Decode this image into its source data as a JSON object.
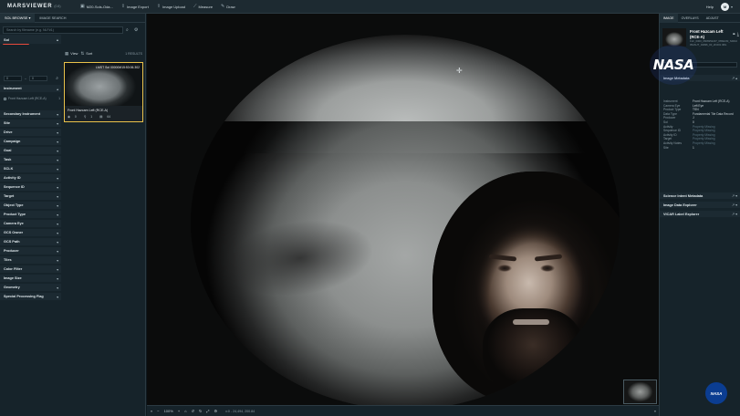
{
  "app": {
    "name": "MARSVIEWER",
    "version": "(0.8)"
  },
  "toolbar": {
    "items": [
      {
        "label": "M20-Sols-Oda...",
        "icon": "folder-icon"
      },
      {
        "label": "Image Export",
        "icon": "export-icon"
      },
      {
        "label": "Image Upload",
        "icon": "upload-icon"
      },
      {
        "label": "Measure",
        "icon": "ruler-icon"
      },
      {
        "label": "Draw",
        "icon": "pencil-icon"
      }
    ],
    "help": "Help",
    "user_initial": "M"
  },
  "left": {
    "tabs": [
      "SOL BROWSE",
      "IMAGE SEARCH"
    ],
    "search_placeholder": "Search by filename (e.g. NLF#1)",
    "chip": "Filter: Both",
    "sol_header": "Sol",
    "sol_from": "0",
    "sol_to": "0",
    "instrument_option": {
      "label": "Front Hazcam Left (RCE-A)",
      "count": "1"
    },
    "facets": [
      "Instrument",
      "Secondary Instrument",
      "Site",
      "Drive",
      "Campaign",
      "Goal",
      "Task",
      "SCLK",
      "Activity ID",
      "Sequence ID",
      "Target",
      "Object Type",
      "Product Type",
      "Camera Eye",
      "GCS Owner",
      "GCS Path",
      "Producer",
      "Tiles",
      "Color Filter",
      "Image Size",
      "Geometry",
      "Special Processing Flag"
    ],
    "results_view": "View",
    "results_sort": "Sort",
    "results_count": "1 RESULTS",
    "result": {
      "stamp": "LMST Sol 00000M15:53:06.302",
      "title": "Front Hazcam Left (RCE-A)",
      "meta": [
        "0",
        "1",
        "64"
      ]
    }
  },
  "viewer": {
    "zoom": "100%",
    "coords": "x:0 - 24,494, 200.84",
    "controls": [
      "«",
      "−",
      "100%",
      "+",
      "⌂",
      "↺",
      "↻",
      "⤢",
      "⚙"
    ],
    "expand": "»"
  },
  "right": {
    "tabs": [
      "IMAGE",
      "OVERLAYS",
      "ADJUST"
    ],
    "image_name": "Front Hazcam Left (RCE-A)",
    "file_id": "FLF_0000_0666952207_665ECM_N0010052AUT_04096_00_2I3J01.IMG",
    "sections": [
      "Image Metadata",
      "Science Intent Metadata",
      "Image Data Explorer",
      "VICAR Label Explorer"
    ],
    "metadata": [
      {
        "k": "Instrument",
        "v": "Front Hazcam Left (RCE-A)",
        "missing": false
      },
      {
        "k": "Camera Eye",
        "v": "Left Eye",
        "missing": false
      },
      {
        "k": "Product Type",
        "v": "TSN",
        "missing": false
      },
      {
        "k": "Data Type",
        "v": "Fundamental Tile Data Record",
        "missing": false
      },
      {
        "k": "Producer",
        "v": "J",
        "missing": false
      },
      {
        "k": "Sol",
        "v": "0",
        "missing": false
      },
      {
        "k": "Activity",
        "v": "Property Missing",
        "missing": true
      },
      {
        "k": "Sequence ID",
        "v": "Property Missing",
        "missing": true
      },
      {
        "k": "Activity ID",
        "v": "Property Missing",
        "missing": true
      },
      {
        "k": "Target",
        "v": "Property Missing",
        "missing": true
      },
      {
        "k": "Activity Notes",
        "v": "Property Missing",
        "missing": true
      },
      {
        "k": "Site",
        "v": "1",
        "missing": false
      }
    ],
    "show_more": "Show More",
    "nasa": "NASA"
  }
}
